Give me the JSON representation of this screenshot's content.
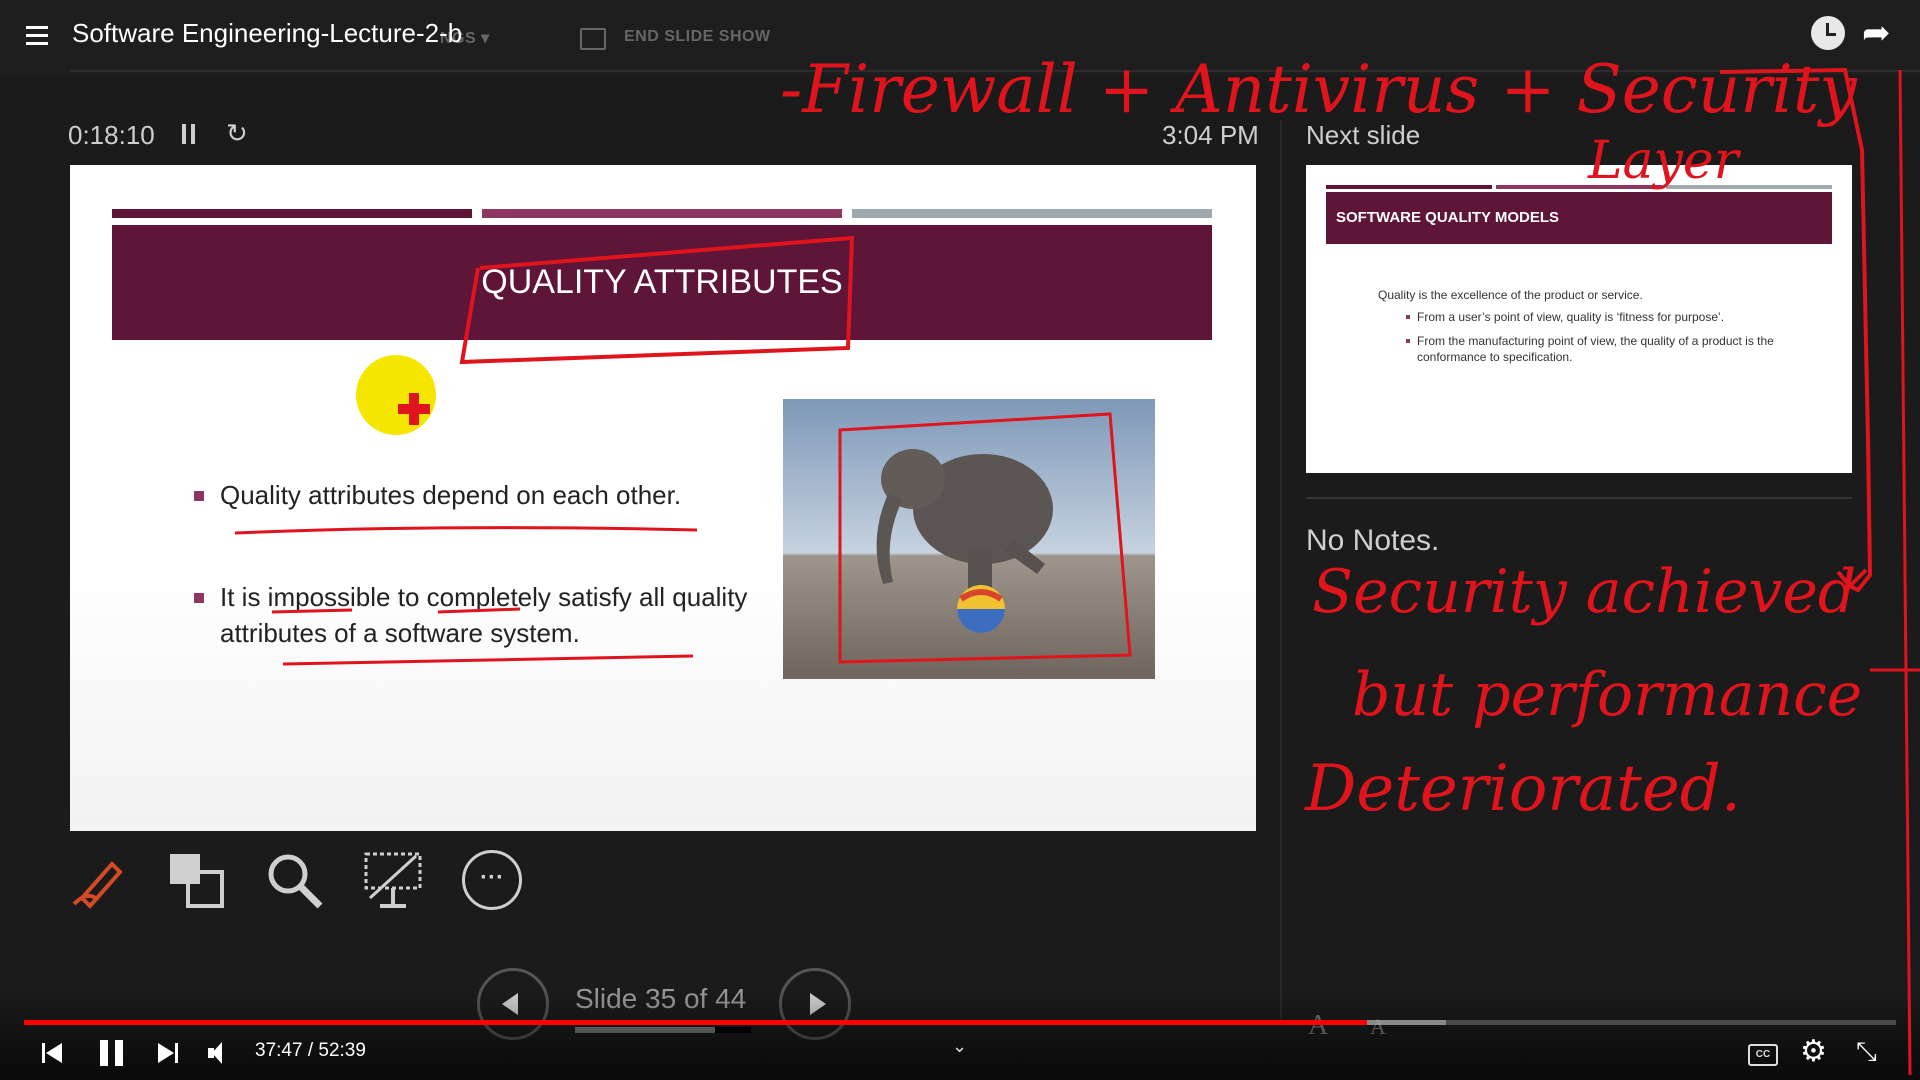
{
  "video": {
    "title": "Software Engineering-Lecture-2-b",
    "time_display": "37:47 / 52:39",
    "progress_fraction": 0.7175
  },
  "presenter": {
    "menu_ghost": "NGS ▾",
    "end_show_label": "END SLIDE SHOW",
    "elapsed": "0:18:10",
    "clock": "3:04 PM",
    "next_heading": "Next slide",
    "notes": "No Notes.",
    "slide_counter": "Slide 35 of 44",
    "slide_progress_fraction": 0.795,
    "font_increase": "A",
    "font_decrease": "A"
  },
  "current_slide": {
    "title": "QUALITY ATTRIBUTES",
    "bullets": [
      "Quality attributes depend on each other.",
      "It is impossible to completely satisfy all quality attributes of a software system."
    ]
  },
  "next_slide": {
    "title": "SOFTWARE QUALITY MODELS",
    "line1": "Quality is the excellence of the product or service.",
    "bullets": [
      "From a user’s point of view, quality is ‘fitness for purpose’.",
      "From the manufacturing point of view, the quality of a product is the conformance to specification."
    ]
  },
  "annotations": {
    "top_line": "-Firewall + Antivirus + Security",
    "top_line2": "Layer",
    "right_line1": "Security achieved",
    "right_line2": "but performance",
    "right_line3": "Deteriorated."
  },
  "colors": {
    "slide_band": "#5e1538",
    "accent": "#8d3661",
    "ink": "#e0141c",
    "yt_progress": "#ff0000"
  },
  "icons": [
    "menu-icon",
    "watch-later-icon",
    "share-icon",
    "pause-icon",
    "restart-icon",
    "pen-icon",
    "grid-icon",
    "zoom-icon",
    "screen-icon",
    "more-icon",
    "prev-icon",
    "next-icon",
    "cc-icon",
    "settings-icon",
    "exit-fullscreen-icon",
    "volume-icon"
  ]
}
